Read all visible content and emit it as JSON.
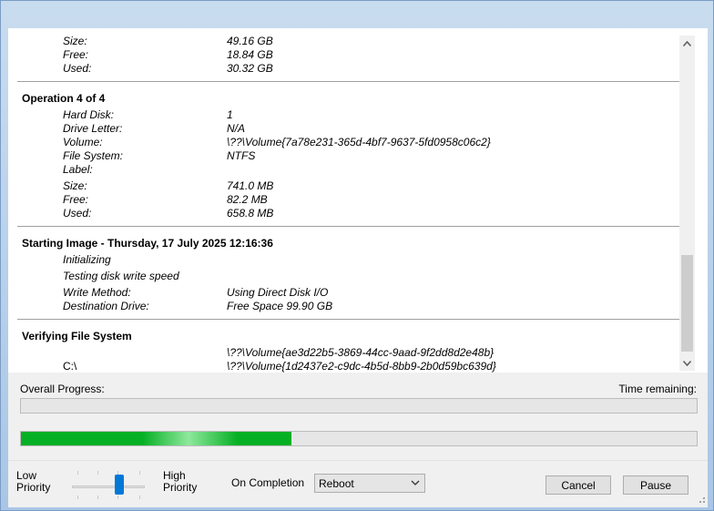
{
  "log": {
    "prev_partition": {
      "size_label": "Size:",
      "size_value": "49.16 GB",
      "free_label": "Free:",
      "free_value": "18.84 GB",
      "used_label": "Used:",
      "used_value": "30.32 GB"
    },
    "operation4": {
      "title": "Operation 4 of 4",
      "hard_disk_label": "Hard Disk:",
      "hard_disk_value": "1",
      "drive_letter_label": "Drive Letter:",
      "drive_letter_value": "N/A",
      "volume_label": "Volume:",
      "volume_value": "\\??\\Volume{7a78e231-365d-4bf7-9637-5fd0958c06c2}",
      "file_system_label": "File System:",
      "file_system_value": "NTFS",
      "label_label": "Label:",
      "label_value": "",
      "size_label": "Size:",
      "size_value": "741.0 MB",
      "free_label": "Free:",
      "free_value": "82.2 MB",
      "used_label": "Used:",
      "used_value": "658.8 MB"
    },
    "starting_image": {
      "title": "Starting Image - Thursday, 17 July 2025 12:16:36",
      "line1": "Initializing",
      "line2": "Testing disk write speed",
      "write_method_label": "Write Method:",
      "write_method_value": "Using Direct Disk I/O",
      "destination_label": "Destination Drive:",
      "destination_value": "Free Space 99.90 GB"
    },
    "verifying": {
      "title": "Verifying File System",
      "volume_line": "\\??\\Volume{ae3d22b5-3869-44cc-9aad-9f2dd8d2e48b}",
      "drive_label": "C:\\",
      "drive_volume": "\\??\\Volume{1d2437e2-c9dc-4b5d-8bb9-2b0d59bc639d}"
    }
  },
  "scrollbar": {
    "position_fraction": 0.72
  },
  "progress": {
    "overall_label": "Overall Progress:",
    "time_remaining_label": "Time remaining:",
    "overall_fraction": 0,
    "current_fraction": 0.4
  },
  "bottom": {
    "priority_low": "Low\nPriority",
    "priority_low_1": "Low",
    "priority_low_2": "Priority",
    "priority_high_1": "High",
    "priority_high_2": "Priority",
    "priority_level_fraction": 0.65,
    "on_completion_label": "On Completion",
    "on_completion_value": "Reboot",
    "cancel_label": "Cancel",
    "pause_label": "Pause"
  },
  "colors": {
    "progress_green": "#06b025",
    "slider_blue": "#0078d7"
  }
}
